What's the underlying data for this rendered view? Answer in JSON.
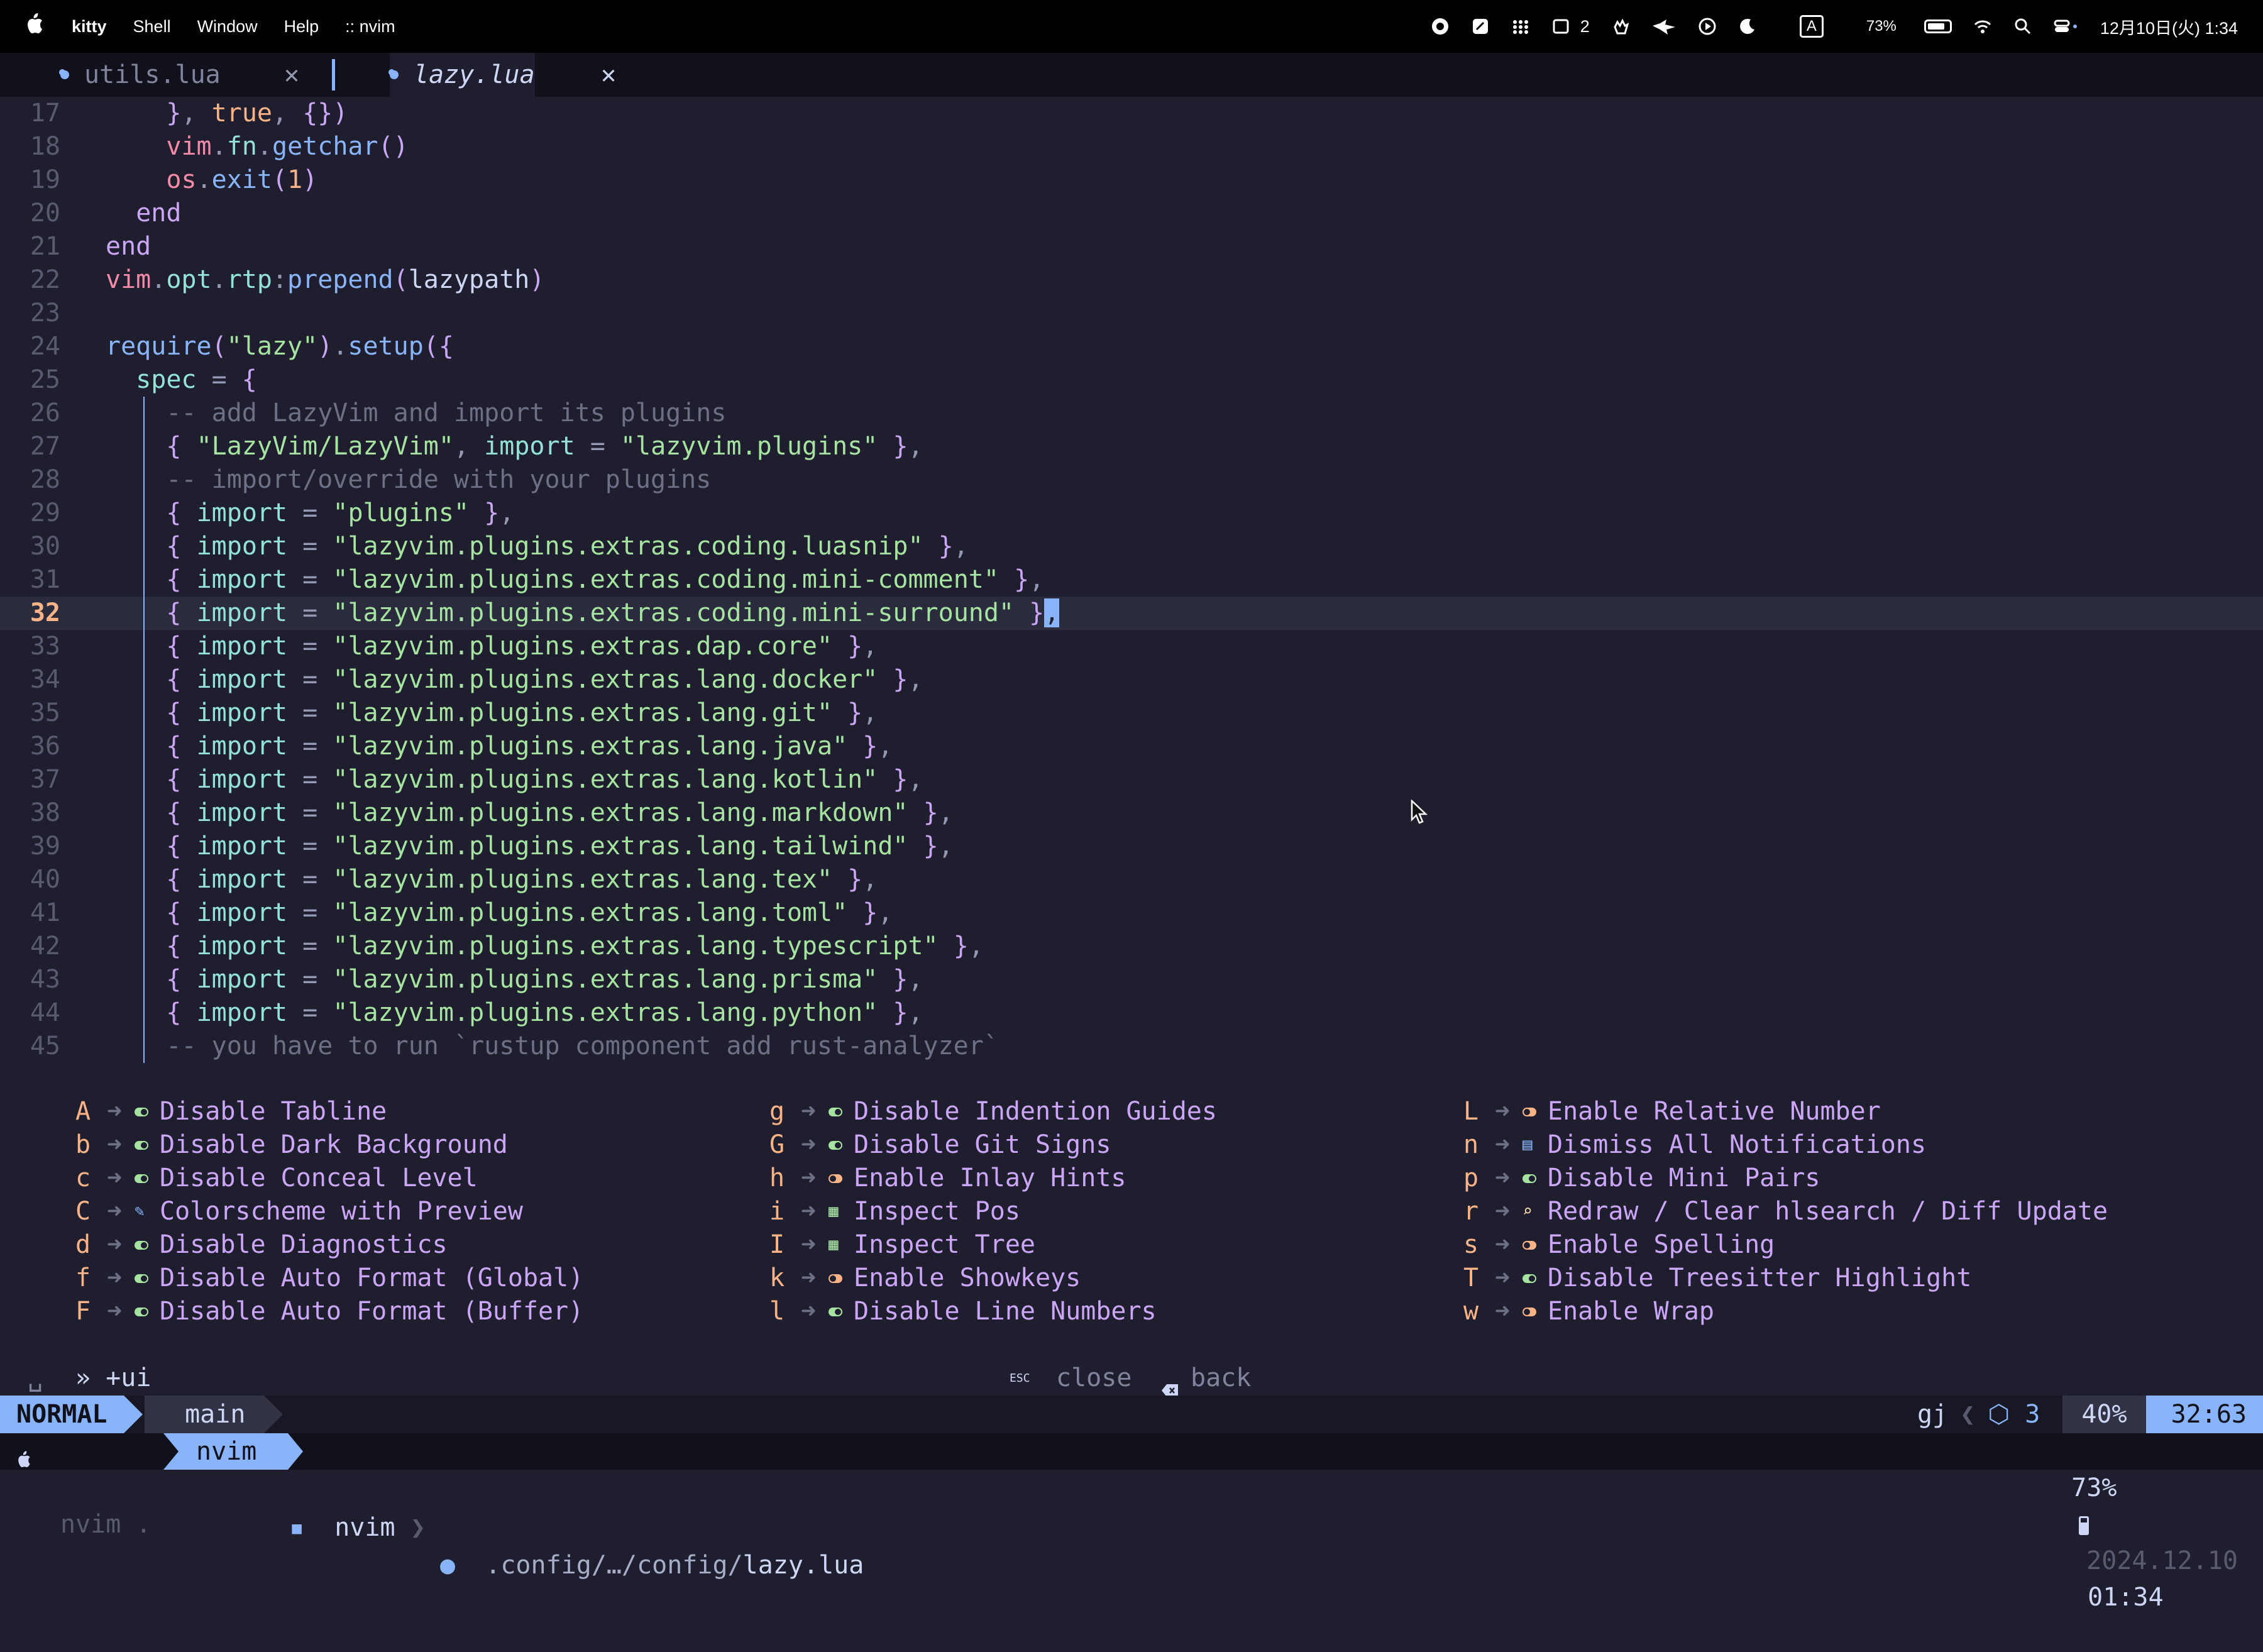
{
  "menubar": {
    "apple": "",
    "app": "kitty",
    "items": [
      "Shell",
      "Window",
      "Help",
      ":: nvim"
    ],
    "spaces_count": "2",
    "battery": "73%",
    "datetime": "12月10日(火)  1:34",
    "input_mode": "A"
  },
  "tabs": [
    {
      "label": "utils.lua",
      "close": "✕"
    },
    {
      "label": "lazy.lua",
      "close": "✕"
    }
  ],
  "editor": {
    "lines": [
      {
        "n": "17",
        "code": "}, true, {})"
      },
      {
        "n": "18",
        "code": "vim.fn.getchar()"
      },
      {
        "n": "19",
        "code": "os.exit(1)"
      },
      {
        "n": "20",
        "code": "end"
      },
      {
        "n": "21",
        "code": "end"
      },
      {
        "n": "22",
        "code": "vim.opt.rtp:prepend(lazypath)"
      },
      {
        "n": "23",
        "code": ""
      },
      {
        "n": "24",
        "code": "require(\"lazy\").setup({"
      },
      {
        "n": "25",
        "code": "spec = {"
      },
      {
        "n": "26",
        "code": "-- add LazyVim and import its plugins"
      },
      {
        "n": "27",
        "code": "{ \"LazyVim/LazyVim\", import = \"lazyvim.plugins\" },"
      },
      {
        "n": "28",
        "code": "-- import/override with your plugins"
      },
      {
        "n": "29",
        "code": "{ import = \"plugins\" },"
      },
      {
        "n": "30",
        "code": "{ import = \"lazyvim.plugins.extras.coding.luasnip\" },"
      },
      {
        "n": "31",
        "code": "{ import = \"lazyvim.plugins.extras.coding.mini-comment\" },"
      },
      {
        "n": "32",
        "code": "{ import = \"lazyvim.plugins.extras.coding.mini-surround\" },"
      },
      {
        "n": "33",
        "code": "{ import = \"lazyvim.plugins.extras.dap.core\" },"
      },
      {
        "n": "34",
        "code": "{ import = \"lazyvim.plugins.extras.lang.docker\" },"
      },
      {
        "n": "35",
        "code": "{ import = \"lazyvim.plugins.extras.lang.git\" },"
      },
      {
        "n": "36",
        "code": "{ import = \"lazyvim.plugins.extras.lang.java\" },"
      },
      {
        "n": "37",
        "code": "{ import = \"lazyvim.plugins.extras.lang.kotlin\" },"
      },
      {
        "n": "38",
        "code": "{ import = \"lazyvim.plugins.extras.lang.markdown\" },"
      },
      {
        "n": "39",
        "code": "{ import = \"lazyvim.plugins.extras.lang.tailwind\" },"
      },
      {
        "n": "40",
        "code": "{ import = \"lazyvim.plugins.extras.lang.tex\" },"
      },
      {
        "n": "41",
        "code": "{ import = \"lazyvim.plugins.extras.lang.toml\" },"
      },
      {
        "n": "42",
        "code": "{ import = \"lazyvim.plugins.extras.lang.typescript\" },"
      },
      {
        "n": "43",
        "code": "{ import = \"lazyvim.plugins.extras.lang.prisma\" },"
      },
      {
        "n": "44",
        "code": "{ import = \"lazyvim.plugins.extras.lang.python\" },"
      },
      {
        "n": "45",
        "code": "-- you have to run `rustup component add rust-analyzer`"
      }
    ],
    "current_line": "32"
  },
  "whichkey": {
    "arrow": "➜",
    "columns": [
      [
        {
          "key": "A",
          "icon": "toggle-on",
          "desc": "Disable Tabline"
        },
        {
          "key": "b",
          "icon": "toggle-on",
          "desc": "Disable Dark Background"
        },
        {
          "key": "c",
          "icon": "toggle-on",
          "desc": "Disable Conceal Level"
        },
        {
          "key": "C",
          "icon": "palette",
          "desc": "Colorscheme with Preview"
        },
        {
          "key": "d",
          "icon": "toggle-on",
          "desc": "Disable Diagnostics"
        },
        {
          "key": "f",
          "icon": "toggle-on",
          "desc": "Disable Auto Format (Global)"
        },
        {
          "key": "F",
          "icon": "toggle-on",
          "desc": "Disable Auto Format (Buffer)"
        }
      ],
      [
        {
          "key": "g",
          "icon": "toggle-on",
          "desc": "Disable Indention Guides"
        },
        {
          "key": "G",
          "icon": "toggle-on",
          "desc": "Disable Git Signs"
        },
        {
          "key": "h",
          "icon": "toggle-off",
          "desc": "Enable Inlay Hints"
        },
        {
          "key": "i",
          "icon": "tree",
          "desc": "Inspect Pos"
        },
        {
          "key": "I",
          "icon": "tree",
          "desc": "Inspect Tree"
        },
        {
          "key": "k",
          "icon": "toggle-off",
          "desc": "Enable Showkeys"
        },
        {
          "key": "l",
          "icon": "toggle-on",
          "desc": "Disable Line Numbers"
        }
      ],
      [
        {
          "key": "L",
          "icon": "toggle-off",
          "desc": "Enable Relative Number"
        },
        {
          "key": "n",
          "icon": "notification",
          "desc": "Dismiss All Notifications"
        },
        {
          "key": "p",
          "icon": "toggle-on",
          "desc": "Disable Mini Pairs"
        },
        {
          "key": "r",
          "icon": "search",
          "desc": "Redraw / Clear hlsearch / Diff Update"
        },
        {
          "key": "s",
          "icon": "toggle-off",
          "desc": "Enable Spelling"
        },
        {
          "key": "T",
          "icon": "toggle-on",
          "desc": "Disable Treesitter Highlight"
        },
        {
          "key": "w",
          "icon": "toggle-off",
          "desc": "Enable Wrap"
        }
      ]
    ],
    "footer": {
      "leader": "␣",
      "breadcrumb": "» +ui",
      "esc_key": "ESC",
      "close_label": "close",
      "back_label": "back"
    }
  },
  "statusline": {
    "mode": "NORMAL",
    "branch": "main",
    "dir": "nvim",
    "file_prefix": ".config/…/config/",
    "file_name": "lazy.lua",
    "gj": "gj",
    "diag_count": "3",
    "percent": "40%",
    "position": "32:63"
  },
  "tmux": {
    "win1": "nvim .",
    "win2": "nvim",
    "battery": "73%",
    "date": "2024.12.10",
    "time": "01:34"
  },
  "colors": {
    "background": "#1e1e2e",
    "accent": "#89b4fa",
    "string": "#a6e3a1",
    "keyword": "#cba6f7",
    "orange": "#fab387"
  }
}
